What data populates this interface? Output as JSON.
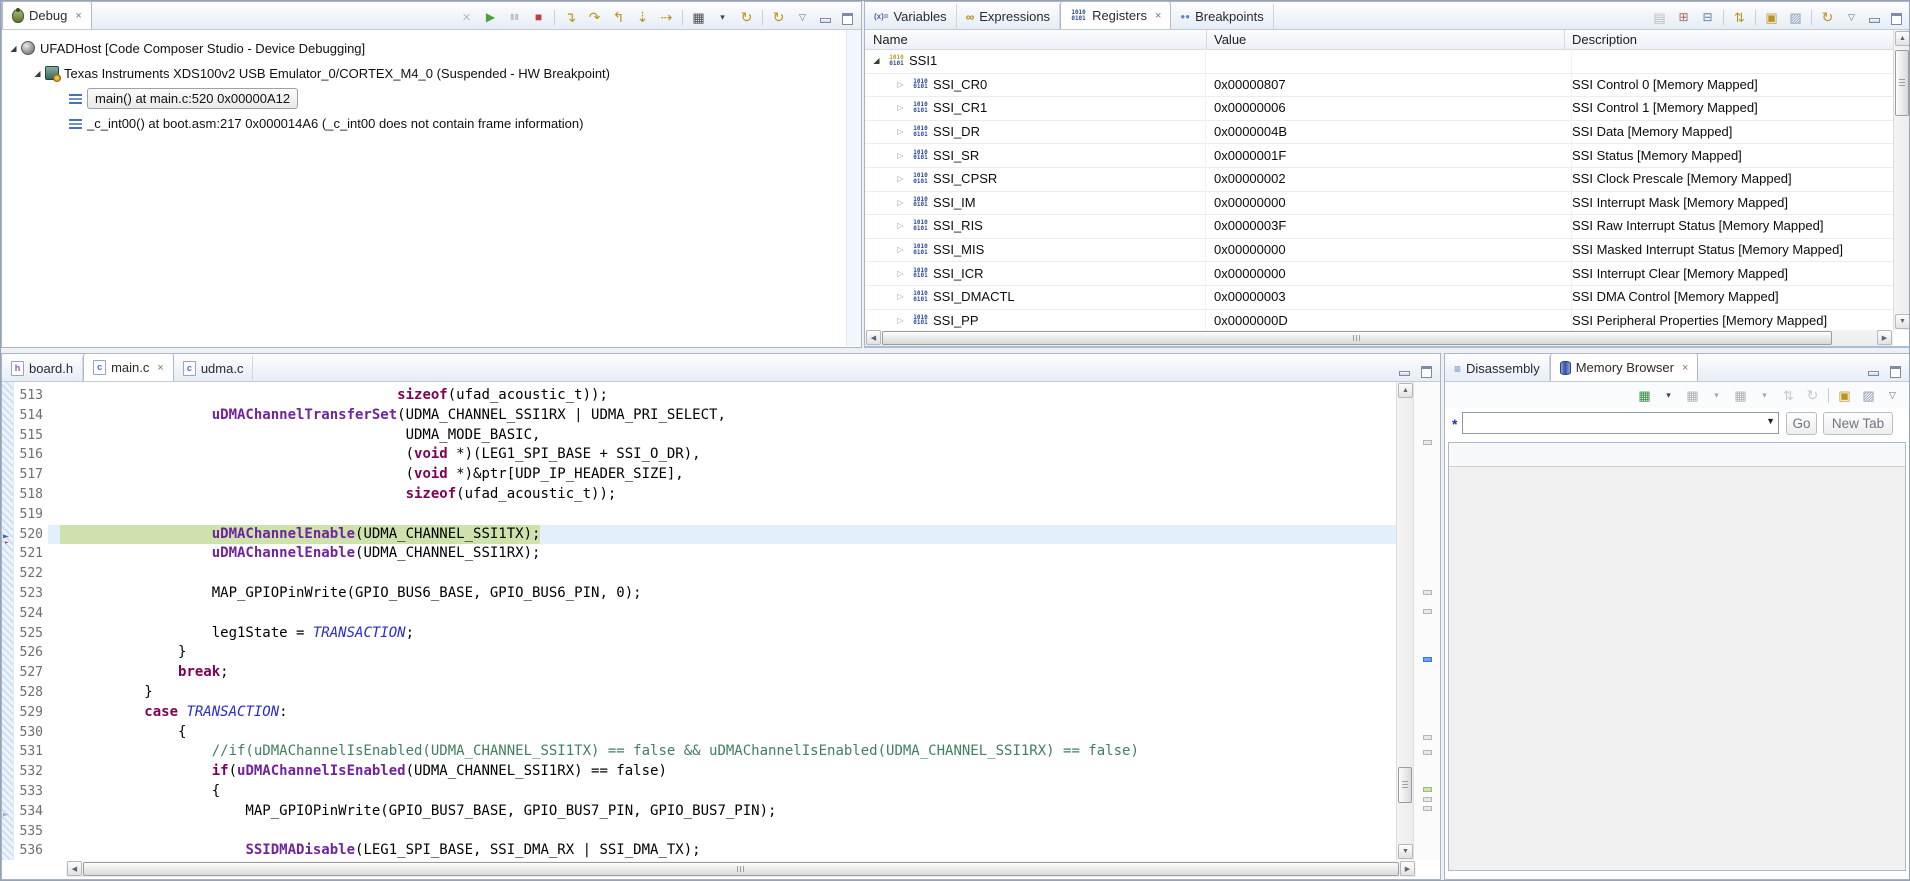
{
  "colors": {
    "keyword": "#7f0055",
    "function": "#71239f",
    "enum_constant": "#2a2ad4",
    "comment": "#3f7f5f",
    "line_number": "#6e6e6e",
    "current_line_green": "#cde3ab",
    "current_line_blue": "#e4effc",
    "accent_blue": "#4a72b0"
  },
  "debug": {
    "tab": {
      "label": "Debug",
      "icon": "debug-view",
      "active": true,
      "closable": true
    },
    "toolbar": [
      "disconnect",
      "resume",
      "suspend",
      "terminate",
      "sep",
      "step-into",
      "step-over",
      "step-return",
      "asm-step-into",
      "asm-step-over",
      "sep",
      "flash",
      "dropdown",
      "restart",
      "sep",
      "refresh",
      "view-menu",
      "minimize",
      "maximize"
    ],
    "tree": [
      {
        "level": 0,
        "icon": "debug-target",
        "expanded": true,
        "label": "UFADHost [Code Composer Studio - Device Debugging]"
      },
      {
        "level": 1,
        "icon": "cpu-core",
        "expanded": true,
        "label": "Texas Instruments XDS100v2 USB Emulator_0/CORTEX_M4_0 (Suspended - HW Breakpoint)"
      },
      {
        "level": 2,
        "icon": "stack-frame",
        "selected": true,
        "label": "main() at main.c:520 0x00000A12"
      },
      {
        "level": 2,
        "icon": "stack-frame",
        "label": "_c_int00() at boot.asm:217 0x000014A6  (_c_int00 does not contain frame information)"
      }
    ]
  },
  "registers": {
    "tabs": [
      {
        "label": "Variables",
        "icon": "variables"
      },
      {
        "label": "Expressions",
        "icon": "expressions"
      },
      {
        "label": "Registers",
        "icon": "registers",
        "active": true,
        "closable": true
      },
      {
        "label": "Breakpoints",
        "icon": "breakpoints"
      }
    ],
    "toolbar": [
      "show-type-names",
      "expand-tree",
      "collapse-all",
      "sep",
      "import-export",
      "sep",
      "new-view",
      "pin-view",
      "sep",
      "refresh",
      "view-menu",
      "minimize",
      "maximize"
    ],
    "columns": [
      "Name",
      "Value",
      "Description"
    ],
    "rows": [
      {
        "name": "SSI1",
        "group": true,
        "value": "",
        "description": ""
      },
      {
        "name": "SSI_CR0",
        "value": "0x00000807",
        "description": "SSI Control 0 [Memory Mapped]"
      },
      {
        "name": "SSI_CR1",
        "value": "0x00000006",
        "description": "SSI Control 1 [Memory Mapped]"
      },
      {
        "name": "SSI_DR",
        "value": "0x0000004B",
        "description": "SSI Data [Memory Mapped]"
      },
      {
        "name": "SSI_SR",
        "value": "0x0000001F",
        "description": "SSI Status [Memory Mapped]"
      },
      {
        "name": "SSI_CPSR",
        "value": "0x00000002",
        "description": "SSI Clock Prescale [Memory Mapped]"
      },
      {
        "name": "SSI_IM",
        "value": "0x00000000",
        "description": "SSI Interrupt Mask [Memory Mapped]"
      },
      {
        "name": "SSI_RIS",
        "value": "0x0000003F",
        "description": "SSI Raw Interrupt Status [Memory Mapped]"
      },
      {
        "name": "SSI_MIS",
        "value": "0x00000000",
        "description": "SSI Masked Interrupt Status [Memory Mapped]"
      },
      {
        "name": "SSI_ICR",
        "value": "0x00000000",
        "description": "SSI Interrupt Clear [Memory Mapped]"
      },
      {
        "name": "SSI_DMACTL",
        "value": "0x00000003",
        "description": "SSI DMA Control [Memory Mapped]"
      },
      {
        "name": "SSI_PP",
        "value": "0x0000000D",
        "description": "SSI Peripheral Properties [Memory Mapped]"
      }
    ]
  },
  "editor": {
    "tabs": [
      {
        "label": "board.h",
        "icon": "h-file"
      },
      {
        "label": "main.c",
        "icon": "c-file",
        "active": true,
        "closable": true
      },
      {
        "label": "udma.c",
        "icon": "c-file"
      }
    ],
    "window_buttons": [
      "minimize",
      "maximize"
    ],
    "lines": [
      {
        "num": 513,
        "segs": [
          [
            "p",
            "                                        "
          ],
          [
            "k",
            "sizeof"
          ],
          [
            "p",
            "(ufad_acoustic_t));"
          ]
        ]
      },
      {
        "num": 514,
        "segs": [
          [
            "p",
            "                  "
          ],
          [
            "f",
            "uDMAChannelTransferSet"
          ],
          [
            "p",
            "(UDMA_CHANNEL_SSI1RX | UDMA_PRI_SELECT,"
          ]
        ]
      },
      {
        "num": 515,
        "segs": [
          [
            "p",
            "                                         UDMA_MODE_BASIC,"
          ]
        ]
      },
      {
        "num": 516,
        "segs": [
          [
            "p",
            "                                         ("
          ],
          [
            "k",
            "void"
          ],
          [
            "p",
            " *)(LEG1_SPI_BASE + SSI_O_DR),"
          ]
        ]
      },
      {
        "num": 517,
        "segs": [
          [
            "p",
            "                                         ("
          ],
          [
            "k",
            "void"
          ],
          [
            "p",
            " *)&ptr[UDP_IP_HEADER_SIZE],"
          ]
        ]
      },
      {
        "num": 518,
        "segs": [
          [
            "p",
            "                                         "
          ],
          [
            "k",
            "sizeof"
          ],
          [
            "p",
            "(ufad_acoustic_t));"
          ]
        ]
      },
      {
        "num": 519,
        "segs": []
      },
      {
        "num": 520,
        "current": true,
        "marker": "instruction-pointer",
        "segs": [
          [
            "p",
            "                  "
          ],
          [
            "f",
            "uDMAChannelEnable"
          ],
          [
            "p",
            "(UDMA_CHANNEL_SSI1TX);"
          ]
        ]
      },
      {
        "num": 521,
        "segs": [
          [
            "p",
            "                  "
          ],
          [
            "f",
            "uDMAChannelEnable"
          ],
          [
            "p",
            "(UDMA_CHANNEL_SSI1RX);"
          ]
        ]
      },
      {
        "num": 522,
        "segs": []
      },
      {
        "num": 523,
        "segs": [
          [
            "p",
            "                  MAP_GPIOPinWrite(GPIO_BUS6_BASE, GPIO_BUS6_PIN, 0);"
          ]
        ]
      },
      {
        "num": 524,
        "segs": []
      },
      {
        "num": 525,
        "segs": [
          [
            "p",
            "                  leg1State = "
          ],
          [
            "e",
            "TRANSACTION"
          ],
          [
            "p",
            ";"
          ]
        ]
      },
      {
        "num": 526,
        "segs": [
          [
            "p",
            "              }"
          ]
        ]
      },
      {
        "num": 527,
        "segs": [
          [
            "p",
            "              "
          ],
          [
            "k",
            "break"
          ],
          [
            "p",
            ";"
          ]
        ]
      },
      {
        "num": 528,
        "segs": [
          [
            "p",
            "          }"
          ]
        ]
      },
      {
        "num": 529,
        "segs": [
          [
            "p",
            "          "
          ],
          [
            "k",
            "case"
          ],
          [
            "p",
            " "
          ],
          [
            "e",
            "TRANSACTION"
          ],
          [
            "p",
            ":"
          ]
        ]
      },
      {
        "num": 530,
        "segs": [
          [
            "p",
            "              {"
          ]
        ]
      },
      {
        "num": 531,
        "segs": [
          [
            "p",
            "                  "
          ],
          [
            "c",
            "//if(uDMAChannelIsEnabled(UDMA_CHANNEL_SSI1TX) == false && uDMAChannelIsEnabled(UDMA_CHANNEL_SSI1RX) == false)"
          ]
        ]
      },
      {
        "num": 532,
        "segs": [
          [
            "p",
            "                  "
          ],
          [
            "k",
            "if"
          ],
          [
            "p",
            "("
          ],
          [
            "f",
            "uDMAChannelIsEnabled"
          ],
          [
            "p",
            "(UDMA_CHANNEL_SSI1RX) == false)"
          ]
        ]
      },
      {
        "num": 533,
        "segs": [
          [
            "p",
            "                  {"
          ]
        ]
      },
      {
        "num": 534,
        "marker": "line-marker",
        "segs": [
          [
            "p",
            "                      MAP_GPIOPinWrite(GPIO_BUS7_BASE, GPIO_BUS7_PIN, GPIO_BUS7_PIN);"
          ]
        ]
      },
      {
        "num": 535,
        "segs": []
      },
      {
        "num": 536,
        "segs": [
          [
            "p",
            "                      "
          ],
          [
            "f",
            "SSIDMADisable"
          ],
          [
            "p",
            "(LEG1_SPI_BASE, SSI_DMA_RX | SSI_DMA_TX);"
          ]
        ]
      }
    ]
  },
  "memory": {
    "tabs": [
      {
        "label": "Disassembly",
        "icon": "disassembly"
      },
      {
        "label": "Memory Browser",
        "icon": "memory",
        "active": true,
        "closable": true
      }
    ],
    "window_buttons": [
      "minimize",
      "maximize"
    ],
    "toolbar": [
      "load-memory",
      "dropdown",
      "save-memory",
      "dropdown-disabled",
      "fill-memory",
      "dropdown-disabled",
      "import-export-disabled",
      "refresh-disabled",
      "sep",
      "new-view",
      "pin-view",
      "view-menu"
    ],
    "modified_indicator": "*",
    "address_value": "",
    "go_label": "Go",
    "new_tab_label": "New Tab"
  }
}
